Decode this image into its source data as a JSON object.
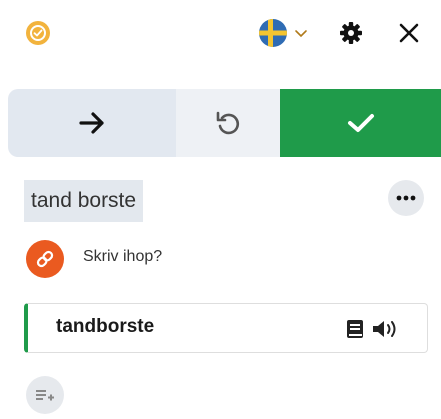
{
  "header": {
    "logo_icon": "checkmark-circle-icon",
    "language_flag": "sweden-flag-icon",
    "language_dropdown_icon": "chevron-down-icon",
    "settings_icon": "gear-icon",
    "close_icon": "close-icon"
  },
  "actions": {
    "next_icon": "arrow-right-icon",
    "undo_icon": "undo-icon",
    "check_icon": "check-icon"
  },
  "exercise": {
    "user_answer": "tand borste",
    "more_icon": "ellipsis-icon",
    "hint_icon": "link-icon",
    "hint_text": "Skriv ihop?"
  },
  "correct_answer": {
    "word": "tandborste",
    "dictionary_icon": "book-icon",
    "audio_icon": "speaker-icon"
  },
  "footer": {
    "add_to_list_icon": "add-to-list-icon"
  },
  "colors": {
    "accent_green": "#1f9b4a",
    "hint_orange": "#ea5a20",
    "logo_yellow": "#f2b33d",
    "flag_blue": "#2f6cb4",
    "flag_yellow": "#f4c531"
  }
}
